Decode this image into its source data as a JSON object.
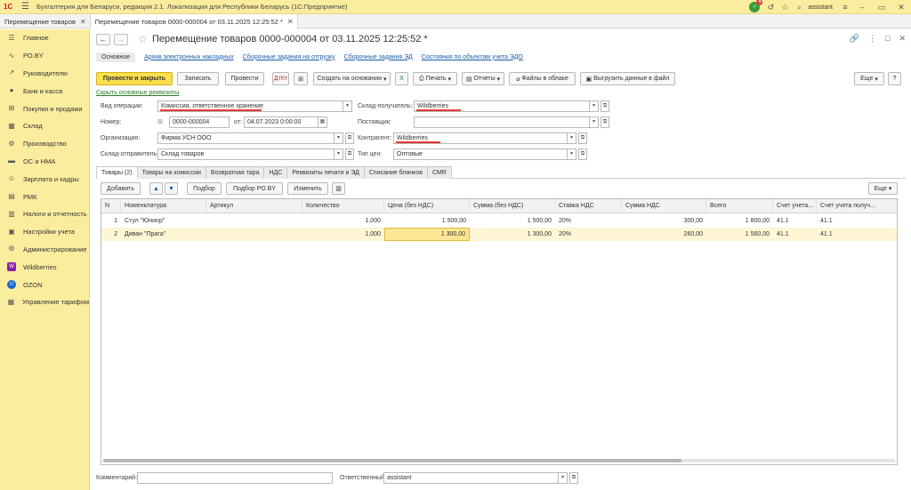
{
  "window": {
    "title": "Бухгалтерия для Беларуси, редакция 2.1. Локализация для Республики Беларусь   (1С:Предприятие)",
    "logo": "1С",
    "notification_count": "4",
    "user": "assistant"
  },
  "open_tabs": [
    {
      "label": "Перемещение товаров"
    },
    {
      "label": "Перемещение товаров 0000-000004 от 03.11.2025 12:25:52 *"
    }
  ],
  "sidebar": {
    "items": [
      {
        "label": "Главное",
        "icon": "menu-icon"
      },
      {
        "label": "РО.BY",
        "icon": "ro-icon"
      },
      {
        "label": "Руководителю",
        "icon": "chart-icon"
      },
      {
        "label": "Банк и касса",
        "icon": "bank-icon"
      },
      {
        "label": "Покупки и продажи",
        "icon": "cart-icon"
      },
      {
        "label": "Склад",
        "icon": "warehouse-icon"
      },
      {
        "label": "Производство",
        "icon": "factory-icon"
      },
      {
        "label": "ОС и НМА",
        "icon": "assets-icon"
      },
      {
        "label": "Зарплата и кадры",
        "icon": "people-icon"
      },
      {
        "label": "РМК",
        "icon": "cashbox-icon"
      },
      {
        "label": "Налоги и отчетность",
        "icon": "tax-icon"
      },
      {
        "label": "Настройки учета",
        "icon": "settings-icon"
      },
      {
        "label": "Администрирование",
        "icon": "gear-icon"
      },
      {
        "label": "Wildberries",
        "icon": "wildberries-icon"
      },
      {
        "label": "OZON",
        "icon": "ozon-icon"
      },
      {
        "label": "Управление тарифом",
        "icon": "tariff-icon"
      }
    ]
  },
  "document": {
    "title": "Перемещение товаров 0000-000004 от 03.11.2025 12:25:52 *",
    "nav_links": [
      "Основное",
      "Архив электронных накладных",
      "Сборочные задания на отгрузку",
      "Сборочные задания ЭД",
      "Состояния по объектам учета ЭДО"
    ]
  },
  "toolbar": {
    "post_close": "Провести и закрыть",
    "save": "Записать",
    "post": "Провести",
    "create_based": "Создать на основании",
    "print": "Печать",
    "reports": "Отчеты",
    "cloud_files": "Файлы в облаке",
    "export_file": "Выгрузить данные в файл",
    "more": "Еще",
    "help": "?"
  },
  "hide_details_link": "Скрыть основные реквизиты",
  "form": {
    "operation_type": {
      "label": "Вид операции:",
      "value": "Комиссия, ответственное хранение"
    },
    "number": {
      "label": "Номер:",
      "value": "0000-000004"
    },
    "date": {
      "label": "от:",
      "value": "04.07.2023  0:00:00"
    },
    "organization": {
      "label": "Организация:",
      "value": "Фирма УСН ООО"
    },
    "sender_warehouse": {
      "label": "Склад-отправитель:",
      "value": "Склад товаров"
    },
    "receiver_warehouse": {
      "label": "Склад-получатель:",
      "value": "Wildberries"
    },
    "supplier": {
      "label": "Поставщик:",
      "value": ""
    },
    "counterparty": {
      "label": "Контрагент:",
      "value": "Wildberries"
    },
    "price_type": {
      "label": "Тип цен:",
      "value": "Оптовые"
    }
  },
  "inner_tabs": [
    "Товары (2)",
    "Товары на комиссии",
    "Возвратная тара",
    "НДС",
    "Реквизиты печати и ЭД",
    "Списание бланков",
    "CMR"
  ],
  "table_toolbar": {
    "add": "Добавить",
    "pick": "Подбор",
    "pick_ro": "Подбор РО.BY",
    "edit": "Изменить",
    "more": "Еще"
  },
  "table": {
    "columns": [
      "N",
      "Номенклатура",
      "Артикул",
      "Количество",
      "Цена (без НДС)",
      "Сумма (без НДС)",
      "Ставка НДС",
      "Сумма НДС",
      "Всего",
      "Счет учета...",
      "Счет учета получ..."
    ],
    "rows": [
      [
        "1",
        "Стул \"Юниор\"",
        "",
        "1,000",
        "1 500,00",
        "1 500,00",
        "20%",
        "300,00",
        "1 800,00",
        "41.1",
        "41.1"
      ],
      [
        "2",
        "Диван \"Прага\"",
        "",
        "1,000",
        "1 300,00",
        "1 300,00",
        "20%",
        "260,00",
        "1 560,00",
        "41.1",
        "41.1"
      ]
    ]
  },
  "footer": {
    "comment_label": "Комментарий:",
    "comment_value": "",
    "responsible_label": "Ответственный:",
    "responsible_value": "assistant"
  },
  "colors": {
    "sidebar_bg": "#fbed9e",
    "primary_button": "#fbdf4c",
    "selected_row": "#fff6d6",
    "link": "#1a5ba8",
    "underline_red": "#e53935"
  }
}
